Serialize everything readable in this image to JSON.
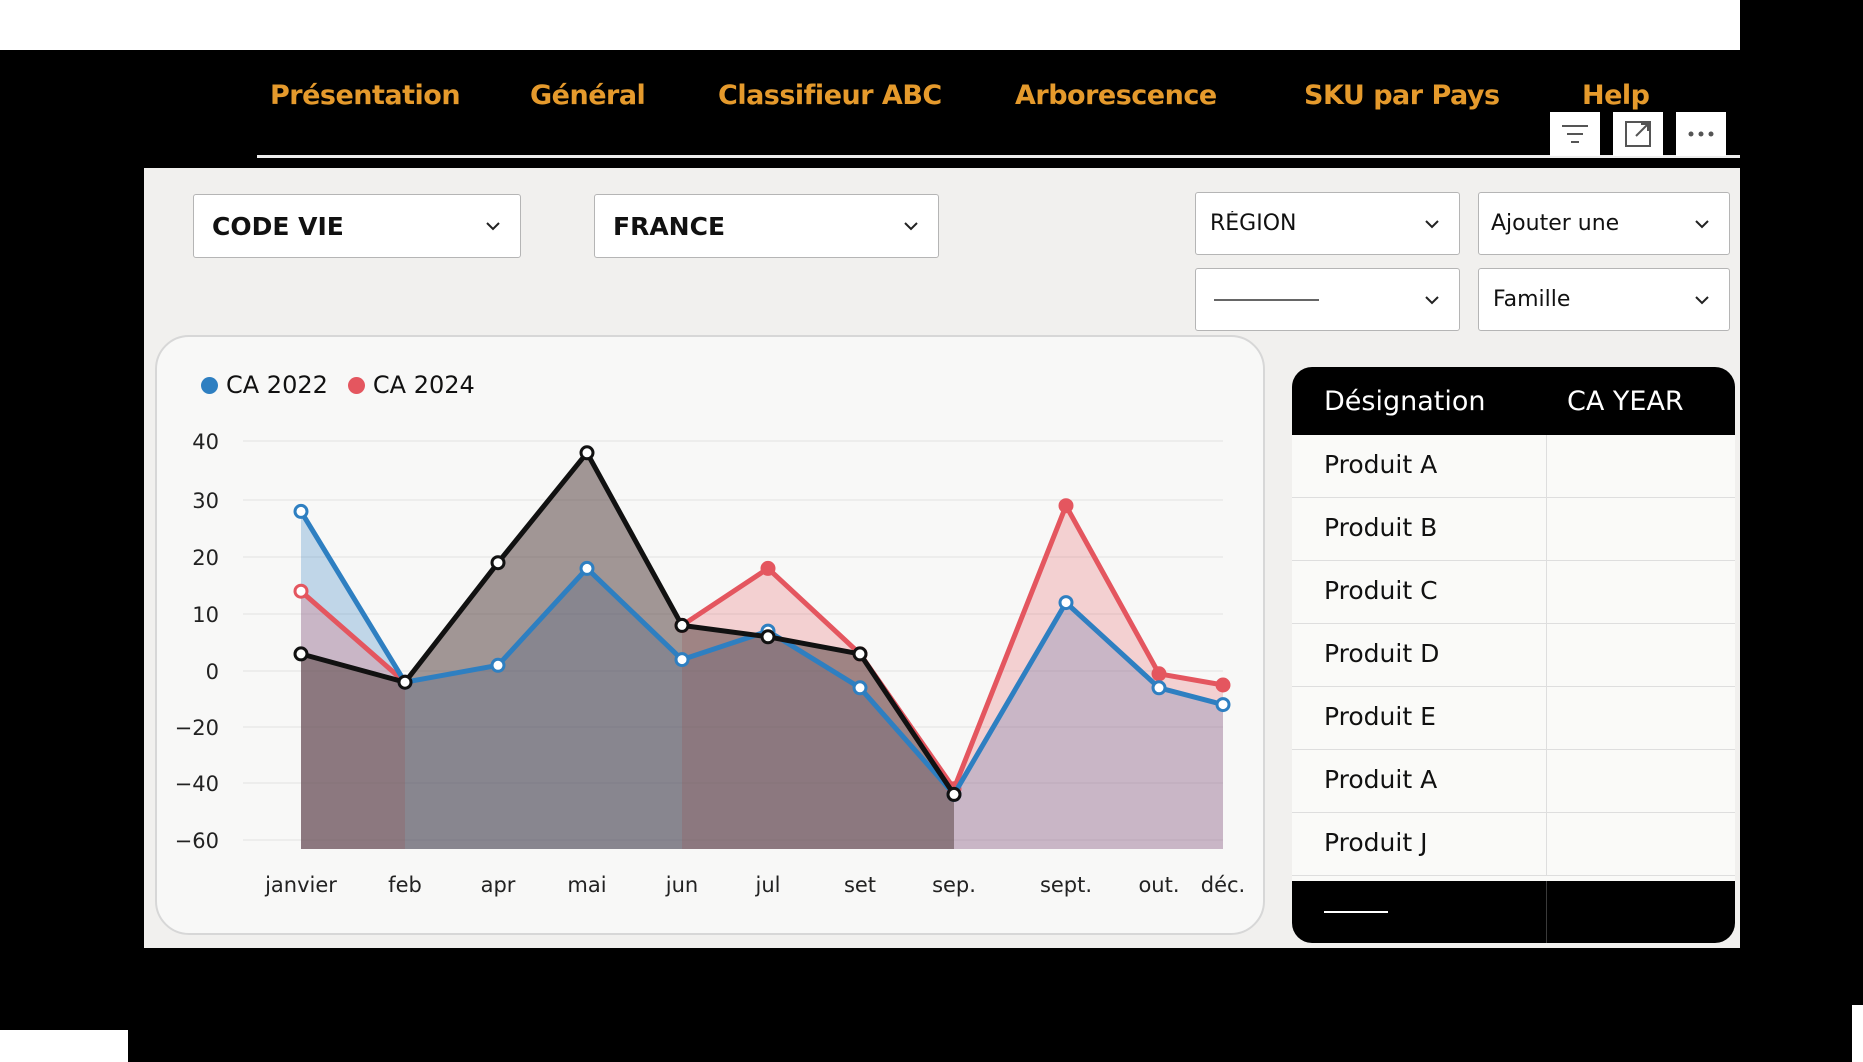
{
  "nav": {
    "tabs": [
      {
        "label": "Présentation"
      },
      {
        "label": "Général"
      },
      {
        "label": "Classifieur ABC"
      },
      {
        "label": "Arborescence"
      },
      {
        "label": "SKU par Pays"
      },
      {
        "label": "Help"
      }
    ]
  },
  "visual_header": {
    "icons": [
      "filter-icon",
      "focus-mode-icon",
      "more-options-icon"
    ]
  },
  "filters": {
    "code_vie": "CODE VIE",
    "pays": "FRANCE",
    "region": "RÉGION",
    "ajouter": "Ajouter une",
    "famille": "Famille"
  },
  "chart_data": {
    "type": "area",
    "categories": [
      "janvier",
      "feb",
      "apr",
      "mai",
      "jun",
      "jul",
      "set",
      "sep.",
      "sept.",
      "out.",
      "déc."
    ],
    "yticks": [
      "40",
      "30",
      "20",
      "10",
      "0",
      "−20",
      "−40",
      "−60"
    ],
    "legend": [
      "CA 2022",
      "CA 2024"
    ],
    "series": [
      {
        "name": "CA 2022",
        "color": "#2e7fc1",
        "values": [
          28,
          -4,
          1,
          18,
          2,
          7,
          -6,
          -44,
          12,
          -6,
          -12
        ]
      },
      {
        "name": "CA 2024",
        "color": "#e4565f",
        "values": [
          14,
          -4,
          null,
          null,
          8,
          18,
          3,
          -42,
          29,
          -1,
          -5
        ]
      },
      {
        "color": "#111111",
        "values": [
          3,
          -4,
          19,
          38,
          8,
          6,
          3,
          -44,
          null,
          null,
          null
        ]
      }
    ],
    "grid": true,
    "legend_position": "top-left"
  },
  "table": {
    "headers": [
      "Désignation",
      "CA YEAR"
    ],
    "rows": [
      {
        "designation": "Produit A",
        "ca": ""
      },
      {
        "designation": "Produit B",
        "ca": ""
      },
      {
        "designation": "Produit C",
        "ca": ""
      },
      {
        "designation": "Produit D",
        "ca": ""
      },
      {
        "designation": "Produit E",
        "ca": ""
      },
      {
        "designation": "Produit A",
        "ca": ""
      },
      {
        "designation": "Produit J",
        "ca": ""
      }
    ]
  },
  "colors": {
    "nav_text": "#e59a2c",
    "series_2022": "#2e7fc1",
    "series_2024": "#e4565f",
    "series_black": "#111111"
  }
}
